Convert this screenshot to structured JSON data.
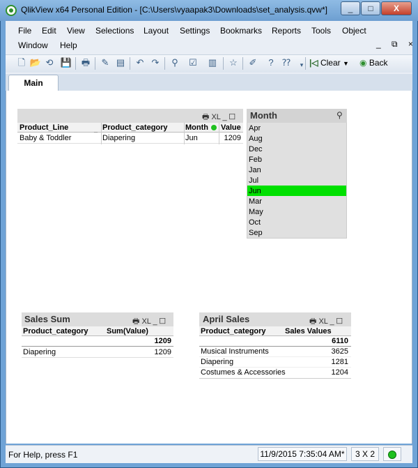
{
  "window": {
    "title": "QlikView x64 Personal Edition - [C:\\Users\\vyaapak3\\Downloads\\set_analysis.qvw*]",
    "minimize": "_",
    "maximize": "□",
    "close": "X"
  },
  "menu": {
    "row1": [
      "File",
      "Edit",
      "View",
      "Selections",
      "Layout",
      "Settings",
      "Bookmarks",
      "Reports",
      "Tools",
      "Object"
    ],
    "row2": [
      "Window",
      "Help"
    ],
    "mdi_controls": "_ ⧉ ×"
  },
  "toolbar": {
    "clear_label": "Clear",
    "back_label": "Back"
  },
  "tabs": {
    "main_label": "Main"
  },
  "table_box": {
    "icons": "🖶 XL _ ☐",
    "headers": [
      "Product_Line",
      "Product_category",
      "Month",
      "Value"
    ],
    "rows": [
      [
        "Baby & Toddler",
        "Diapering",
        "Jun",
        "1209"
      ]
    ]
  },
  "month_listbox": {
    "title": "Month",
    "items": [
      "Apr",
      "Aug",
      "Dec",
      "Feb",
      "Jan",
      "Jul",
      "Jun",
      "Mar",
      "May",
      "Oct",
      "Sep"
    ],
    "selected": "Jun",
    "selected_color": "#00e000"
  },
  "sales_sum": {
    "title": "Sales Sum",
    "icons": "🖶 XL _ ☐",
    "headers": [
      "Product_category",
      "Sum(Value)"
    ],
    "total": "1209",
    "rows": [
      [
        "Diapering",
        "1209"
      ]
    ]
  },
  "april_sales": {
    "title": "April Sales",
    "icons": "🖶 XL _ ☐",
    "headers": [
      "Product_category",
      "Sales Values"
    ],
    "total": "6110",
    "rows": [
      [
        "Musical Instruments",
        "3625"
      ],
      [
        "Diapering",
        "1281"
      ],
      [
        "Costumes & Accessories",
        "1204"
      ]
    ]
  },
  "status": {
    "help": "For Help, press F1",
    "timestamp": "11/9/2015 7:35:04 AM*",
    "grid": "3 X 2"
  }
}
